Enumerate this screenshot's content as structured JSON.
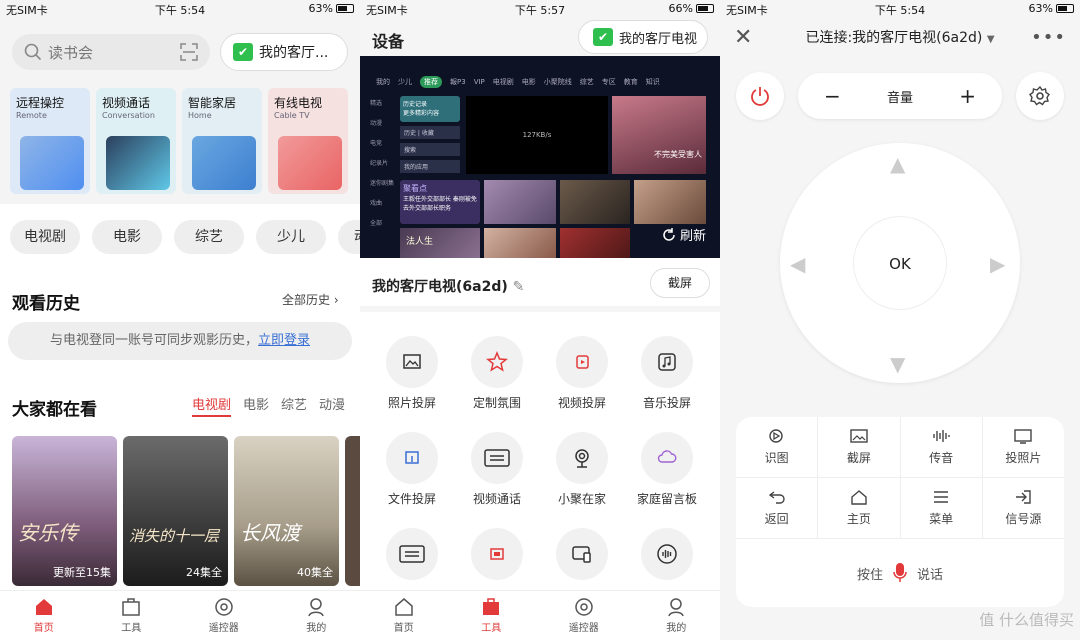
{
  "status_left": {
    "carrier": "无SIM卡",
    "time": "下午 5:54",
    "battery": "63%"
  },
  "status_mid": {
    "carrier": "无SIM卡",
    "time": "下午 5:57",
    "battery": "66%"
  },
  "status_right": {
    "carrier": "无SIM卡",
    "time": "下午 5:54",
    "battery": "63%"
  },
  "home": {
    "search_placeholder": "读书会",
    "tv_button": "我的客厅...",
    "cards": [
      {
        "title": "远程操控",
        "sub": "Remote"
      },
      {
        "title": "视频通话",
        "sub": "Conversation"
      },
      {
        "title": "智能家居",
        "sub": "Home"
      },
      {
        "title": "有线电视",
        "sub": "Cable TV"
      }
    ],
    "chips": [
      "电视剧",
      "电影",
      "综艺",
      "少儿",
      "动"
    ],
    "history_title": "观看历史",
    "history_more": "全部历史",
    "login_text": "与电视登同一账号可同步观影历史，",
    "login_link": "立即登录",
    "popular_title": "大家都在看",
    "popular_tabs": [
      "电视剧",
      "电影",
      "综艺",
      "动漫"
    ],
    "posters": [
      {
        "cap": "安乐传",
        "ep": "更新至15集"
      },
      {
        "cap": "消失的十一层",
        "ep": "24集全"
      },
      {
        "cap": "长风渡",
        "ep": "40集全"
      }
    ]
  },
  "tools": {
    "title": "设备",
    "tv_button": "我的客厅电视",
    "refresh": "刷新",
    "tv_name": "我的客厅电视(6a2d)",
    "screenshot": "截屏",
    "screen": {
      "tabs": [
        "我的",
        "少儿",
        "推荐",
        "報P3",
        "VIP",
        "电视剧",
        "电影",
        "小聚院线",
        "综艺",
        "专区",
        "教育",
        "知识"
      ],
      "side": [
        "精选",
        "动漫",
        "电竞",
        "纪录片",
        "迷你剧集",
        "戏曲",
        "全部"
      ],
      "history_card": "历史记录",
      "history_sub": "更多精彩内容",
      "btn1": "历史 | 收藏",
      "btn2": "搜索",
      "btn3": "我的应用",
      "speed": "127KB/s",
      "focus_title": "聚看点",
      "focus_desc": "王毅任外交部部长 秦刚被免去外交部部长职务",
      "fp_label": "不完美受害人",
      "poster_label": "法人生"
    },
    "items": [
      "照片投屏",
      "定制氛围",
      "视频投屏",
      "音乐投屏",
      "文件投屏",
      "视频通话",
      "小聚在家",
      "家庭留言板"
    ]
  },
  "remote": {
    "title": "已连接:我的客厅电视(6a2d)",
    "volume": "音量",
    "ok": "OK",
    "keys_row1": [
      "识图",
      "截屏",
      "传音",
      "投照片"
    ],
    "keys_row2": [
      "返回",
      "主页",
      "菜单",
      "信号源"
    ],
    "hold": "按住",
    "talk": "说话"
  },
  "nav": [
    "首页",
    "工具",
    "遥控器",
    "我的"
  ],
  "watermark": "值 什么值得买",
  "colors": {
    "accent": "#e23a3a",
    "check": "#2fbf4f",
    "link": "#3a6fd4"
  }
}
